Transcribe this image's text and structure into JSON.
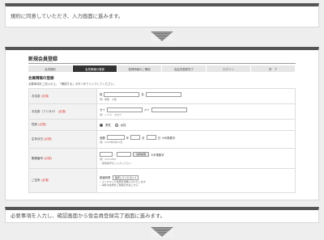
{
  "top_message": "規約に同意していただき、入力画面に進みます。",
  "bottom_message": "必要事項を入力し、確認画面から仮会員登録完了画面に進みます。",
  "form": {
    "title": "新規会員登録",
    "steps": [
      "会員規約",
      "会員情報の登録",
      "登録情報のご確認",
      "仮会員登録完了",
      "ログイン",
      "完　了"
    ],
    "active_step": 1,
    "section_title": "会員情報の登録",
    "section_desc": "必要事項をご記入の上、「確認する」ボタンをクリックしてください。",
    "required_mark": "(必須)",
    "rows": {
      "name": {
        "label": "お名前",
        "sei": "姓",
        "mei": "名",
        "hint": "例）伊藤　大郎"
      },
      "kana": {
        "label": "お名前（フリガナ）",
        "sei": "セイ",
        "mei": "メイ",
        "hint": "例）イトウ　タロウ"
      },
      "gender": {
        "label": "性別",
        "options": [
          "男性",
          "女性"
        ]
      },
      "birthday": {
        "label": "生年月日",
        "era": "西暦",
        "year": "年",
        "month": "月",
        "day": "日",
        "note": "※半角数字",
        "hint": "例）1970年8月20日"
      },
      "zip": {
        "label": "郵便番号",
        "search": "住所検索",
        "note": "※半角数字",
        "hint": "例）123-4567",
        "hint2": "・郵便番号をご入力ください"
      },
      "address": {
        "label": "ご住所",
        "pref_caption": "都道府県",
        "pref_select": "選択してください ▾",
        "bullets": [
          "ブックマンに住所を自動入力いたします",
          "海外の住所をご登録の方はこちら"
        ]
      }
    }
  }
}
